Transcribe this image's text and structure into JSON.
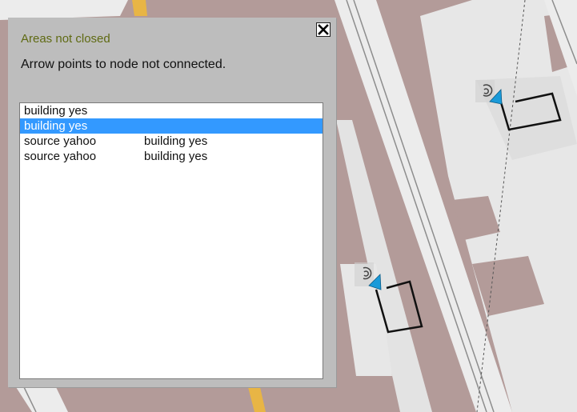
{
  "dialog": {
    "title": "Areas not closed",
    "message": "Arrow points to node not connected.",
    "close_symbol": "X"
  },
  "list": {
    "items": [
      {
        "col1": "building yes",
        "col2": "",
        "selected": false
      },
      {
        "col1": "building yes",
        "col2": "",
        "selected": true
      },
      {
        "col1": "source yahoo",
        "col2": "building yes",
        "selected": false
      },
      {
        "col1": "source yahoo",
        "col2": "building yes",
        "selected": false
      }
    ]
  },
  "colors": {
    "map_block": "#b39b99",
    "map_road": "#ececec",
    "title_text": "#5f6a12",
    "selection": "#3399ff",
    "arrow": "#1a9ad9"
  }
}
